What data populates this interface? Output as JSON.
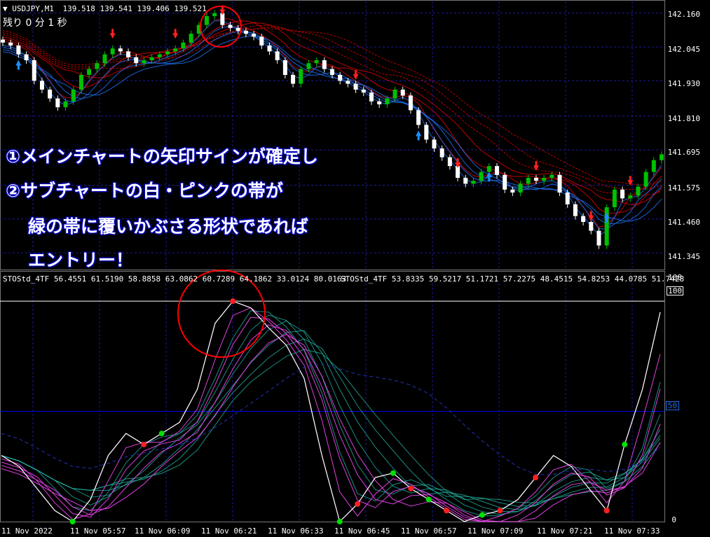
{
  "main_chart": {
    "header_symbol": "USDJPY,M1",
    "header_ohlc": "139.518 139.541 139.406 139.521",
    "countdown": "残り 0 分 1 秒",
    "price_labels": [
      "142.160",
      "142.045",
      "141.930",
      "141.810",
      "141.695",
      "141.575",
      "141.460",
      "141.345"
    ]
  },
  "annotation": {
    "line1": "①メインチャートの矢印サインが確定し",
    "line2": "②サブチャートの白・ピンクの帯が",
    "line3": "緑の帯に覆いかぶさる形状であれば",
    "line4": "エントリー！"
  },
  "sub_chart": {
    "header1": "STOStd_4TF 56.4551 61.5190 58.8858 63.0862 60.7289 64.1862 33.0124 80.0163",
    "header2": "STOStd_4TF 53.8335 59.5217 51.1721 57.2275 48.4515 54.8253 44.0785 51.7428",
    "scale_top": "108",
    "level_100": "100",
    "level_50": "50",
    "level_0": "0"
  },
  "time_axis": [
    "11 Nov 2022",
    "11 Nov 05:57",
    "11 Nov 06:09",
    "11 Nov 06:21",
    "11 Nov 06:33",
    "11 Nov 06:45",
    "11 Nov 06:57",
    "11 Nov 07:09",
    "11 Nov 07:21",
    "11 Nov 07:33"
  ],
  "colors": {
    "background": "#000000",
    "grid": "#1a1aa0",
    "bull": "#00c000",
    "bear": "#ffffff",
    "ma_red": "#e00000",
    "ma_blue": "#1e6ae6",
    "arrow_up": "#1e90ff",
    "arrow_down": "#ff2020",
    "stoch_white": "#ffffff",
    "stoch_pink": "#e040e0",
    "stoch_green": "#20b0a0",
    "level_line": "#0000ff",
    "highlight_circle": "#ff0000"
  },
  "chart_data": [
    {
      "type": "candlestick",
      "title": "USDJPY,M1",
      "ylim": [
        141.3,
        142.2
      ],
      "y_ticks": [
        142.16,
        142.045,
        141.93,
        141.81,
        141.695,
        141.575,
        141.46,
        141.345
      ],
      "close_path": [
        142.06,
        142.05,
        142.02,
        142.0,
        141.93,
        141.9,
        141.87,
        141.84,
        141.86,
        141.9,
        141.95,
        141.97,
        141.99,
        142.02,
        142.04,
        142.03,
        142.01,
        141.99,
        142.0,
        142.01,
        142.02,
        142.03,
        142.04,
        142.06,
        142.09,
        142.12,
        142.15,
        142.16,
        142.12,
        142.11,
        142.1,
        142.09,
        142.08,
        142.05,
        142.03,
        142.0,
        141.95,
        141.92,
        141.97,
        141.99,
        142.0,
        141.97,
        141.95,
        141.93,
        141.92,
        141.9,
        141.89,
        141.86,
        141.85,
        141.87,
        141.9,
        141.88,
        141.83,
        141.78,
        141.73,
        141.7,
        141.67,
        141.64,
        141.6,
        141.58,
        141.59,
        141.62,
        141.64,
        141.61,
        141.56,
        141.55,
        141.58,
        141.6,
        141.59,
        141.6,
        141.61,
        141.55,
        141.51,
        141.47,
        141.45,
        141.42,
        141.37,
        141.5,
        141.56,
        141.53,
        141.54,
        141.57,
        141.62,
        141.66,
        141.68
      ]
    },
    {
      "type": "line",
      "title": "STOStd_4TF",
      "ylim": [
        0,
        108
      ],
      "y_ticks": [
        0,
        50,
        100
      ],
      "series": [
        {
          "values": [
            30,
            25,
            15,
            5,
            0,
            10,
            30,
            40,
            35,
            40,
            45,
            60,
            90,
            100,
            97,
            88,
            80,
            65,
            30,
            0,
            8,
            20,
            22,
            15,
            10,
            5,
            0,
            3,
            5,
            10,
            20,
            30,
            25,
            15,
            5,
            35,
            60,
            95
          ]
        }
      ]
    }
  ]
}
